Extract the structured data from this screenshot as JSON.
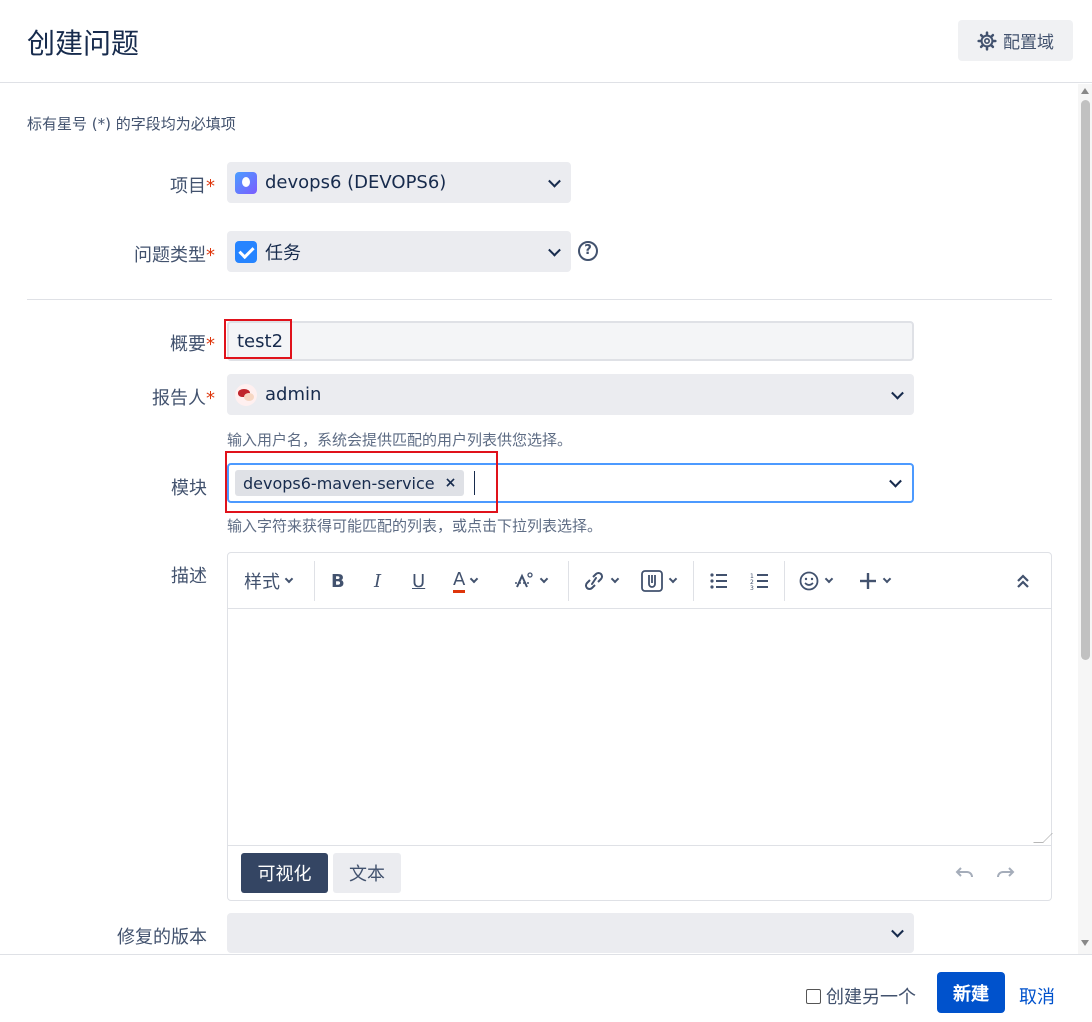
{
  "header": {
    "title": "创建问题",
    "config_label": "配置域"
  },
  "form": {
    "required_note": "标有星号 (*) 的字段均为必填项",
    "required_mark": "*",
    "project": {
      "label": "项目",
      "value": "devops6 (DEVOPS6)"
    },
    "issue_type": {
      "label": "问题类型",
      "value": "任务",
      "help": "?"
    },
    "summary": {
      "label": "概要",
      "value": "test2"
    },
    "reporter": {
      "label": "报告人",
      "value": "admin",
      "hint": "输入用户名，系统会提供匹配的用户列表供您选择。"
    },
    "component": {
      "label": "模块",
      "tag": "devops6-maven-service",
      "tag_remove": "×",
      "hint": "输入字符来获得可能匹配的列表，或点击下拉列表选择。"
    },
    "description": {
      "label": "描述",
      "toolbar": {
        "style": "样式",
        "bold": "B",
        "italic": "I",
        "underline": "U",
        "text_color": "A"
      },
      "mode_visual": "可视化",
      "mode_text": "文本"
    },
    "fix_version": {
      "label": "修复的版本",
      "value": ""
    }
  },
  "footer": {
    "create_another": "创建另一个",
    "create": "新建",
    "cancel": "取消"
  },
  "colors": {
    "primary": "#0052cc",
    "required": "#de350b",
    "highlight": "#e0121b",
    "focus": "#4c9aff"
  }
}
